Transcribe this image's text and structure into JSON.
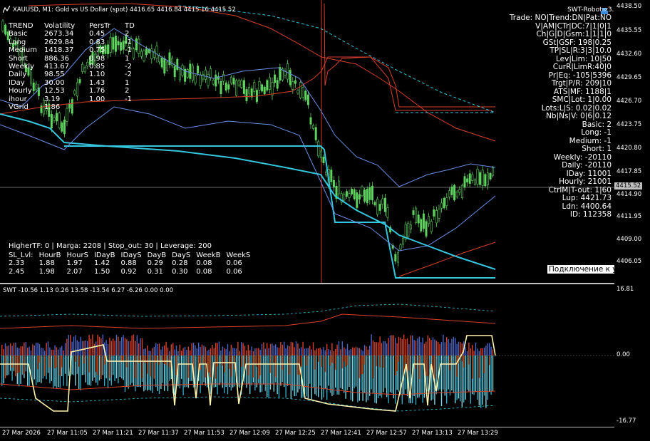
{
  "chart": {
    "symbol_header": "XAUUSD, M1:  Gold vs US Dollar (spot)  4416.65 4416.84 4415.16 4415.52",
    "robot_name": "SWT-Robot v3.0",
    "current_price_label": "4415.52",
    "price_axis": [
      "4438.50",
      "4435.55",
      "4432.60",
      "4429.65",
      "4426.70",
      "4423.75",
      "4420.80",
      "4417.85",
      "4414.90",
      "4411.95",
      "4409.00",
      "4406.05"
    ],
    "sub_axis": [
      "16.81",
      "0.00",
      "-16.77"
    ],
    "sub_header": "SWT -10.56 1.13 0.26 13.58 -13.54 6.27 -6.26 0.00 0.00",
    "time_axis": [
      "27 Mar 2026",
      "27 Mar 11:05",
      "27 Mar 11:21",
      "27 Mar 11:37",
      "27 Mar 11:53",
      "27 Mar 12:09",
      "27 Mar 12:25",
      "27 Mar 12:41",
      "27 Mar 12:57",
      "27 Mar 13:13",
      "27 Mar 13:29"
    ],
    "connection_tooltip": "Подключение к удаленному"
  },
  "trend_table": {
    "headers": [
      "TREND",
      "Volatility",
      "PersTr",
      "TD"
    ],
    "rows": [
      [
        "Basic",
        "2673.34",
        "0.45",
        "2"
      ],
      [
        "Long",
        "2629.84",
        "0.83",
        "-1"
      ],
      [
        "Medium",
        "1418.37",
        "0.75",
        "-1"
      ],
      [
        "Short",
        "886.36",
        "0.98",
        "1"
      ],
      [
        "Weekly",
        "413.67",
        "0.85",
        "-2"
      ],
      [
        "Daily",
        "98.55",
        "1.10",
        "-2"
      ],
      [
        "IDay",
        "30.00",
        "1.43",
        "1"
      ],
      [
        "Hourly",
        "12.53",
        "1.76",
        "2"
      ],
      [
        "ihour",
        "3.19",
        "1.00",
        "-1"
      ],
      [
        "VGrid",
        "1.86",
        "",
        ""
      ]
    ]
  },
  "sl_table": {
    "info": "HigherTF: 0 | Marga: 2208 | Stop_out: 30 | Leverage: 200",
    "headers": [
      "SL_Lvl:",
      "HourB",
      "HourS",
      "IDayB",
      "IDayS",
      "DayB",
      "DayS",
      "WeekB",
      "WeekS"
    ],
    "rows": [
      [
        "2.33",
        "1.88",
        "1.97",
        "1.42",
        "0.88",
        "0.29",
        "0.28",
        "0.08",
        "0.06"
      ],
      [
        "2.45",
        "1.98",
        "2.07",
        "1.50",
        "0.92",
        "0.31",
        "0.30",
        "0.08",
        "0.06"
      ]
    ]
  },
  "robot_panel": [
    "Trade:  NO|Trend:DN|Pat:NO",
    "V|AM|CTr|DC:7|1|0|1",
    "Ch|G|D|Gsm:1|1|1|0",
    "GSt|GSF: 198|0.25",
    "TP|SL|R:3|3|10.0",
    "Lev|Lim: 10|50",
    "CurR|LimR:40|0",
    "Pr|Eq: -105|5396",
    "Trgt|P/R: 209|10",
    "ATS|MF: 1188|1",
    "SMC|Lot: 1|0.00",
    "Lots:L|S: 0.02|0.02",
    "Nb|Ns|V: 0|6|0.12",
    "Basic:  2",
    "Long:  -1",
    "Medium:  -1",
    "Short:  1",
    "Weekly:  -20110",
    "Daily:  -20110",
    "IDay:  11001",
    "Hourly:  21001",
    "CtrlM|T-out: 1|60",
    "Lup: 4421.73",
    "Ldn: 4400.64",
    "ID: 112358"
  ],
  "colors": {
    "background": "#000000",
    "bull_candle": "#5fd35f",
    "cyan_line": "#33c6dd",
    "red_line": "#d8402a",
    "blue_line": "#6b8fe6",
    "yellow_line": "#fff6b0"
  }
}
